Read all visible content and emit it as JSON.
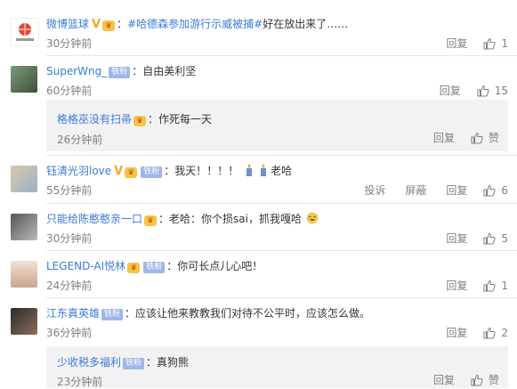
{
  "comments": [
    {
      "user": "微博篮球",
      "hashtag": "#哈德森参加游行示威被捕#",
      "text": "好在放出来了……",
      "time": "30分钟前",
      "actions": [
        "回复"
      ],
      "likes": "1"
    },
    {
      "user": "SuperWng_",
      "badge": "铁粉",
      "text": "自由美利坚",
      "time": "60分钟前",
      "actions": [
        "回复"
      ],
      "likes": "15",
      "reply": {
        "user": "格格巫没有扫帚",
        "text": "作死每一天",
        "time": "26分钟前",
        "actions": [
          "回复"
        ],
        "likes": "赞"
      }
    },
    {
      "user": "钰清光羽love",
      "badge": "铁粉",
      "text_a": "我天！！！！",
      "text_b": "老哈",
      "time": "55分钟前",
      "actions": [
        "投诉",
        "屏蔽",
        "回复"
      ],
      "likes": "6"
    },
    {
      "user": "只能给陈憨憨亲一口",
      "text": "老哈：你个损sai，抓我嘎哈",
      "time": "30分钟前",
      "actions": [
        "回复"
      ],
      "likes": "5"
    },
    {
      "user": "LEGEND-AI悦林",
      "badge": "铁粉",
      "text": "你可长点儿心吧！",
      "time": "24分钟前",
      "actions": [
        "回复"
      ],
      "likes": "1"
    },
    {
      "user": "江东真英雄",
      "badge": "铁粉",
      "text": "应该让他来教教我们对待不公平时，应该怎么做。",
      "time": "36分钟前",
      "actions": [
        "回复"
      ],
      "likes": "2",
      "reply": {
        "user": "少收税多福利",
        "badge": "铁粉",
        "text": "真狗熊",
        "time": "23分钟前",
        "actions": [
          "回复"
        ],
        "likes": "赞"
      }
    }
  ],
  "colors": {
    "link": "#3b7ad9",
    "muted": "#808080",
    "reply_bg": "#f2f2f5"
  }
}
